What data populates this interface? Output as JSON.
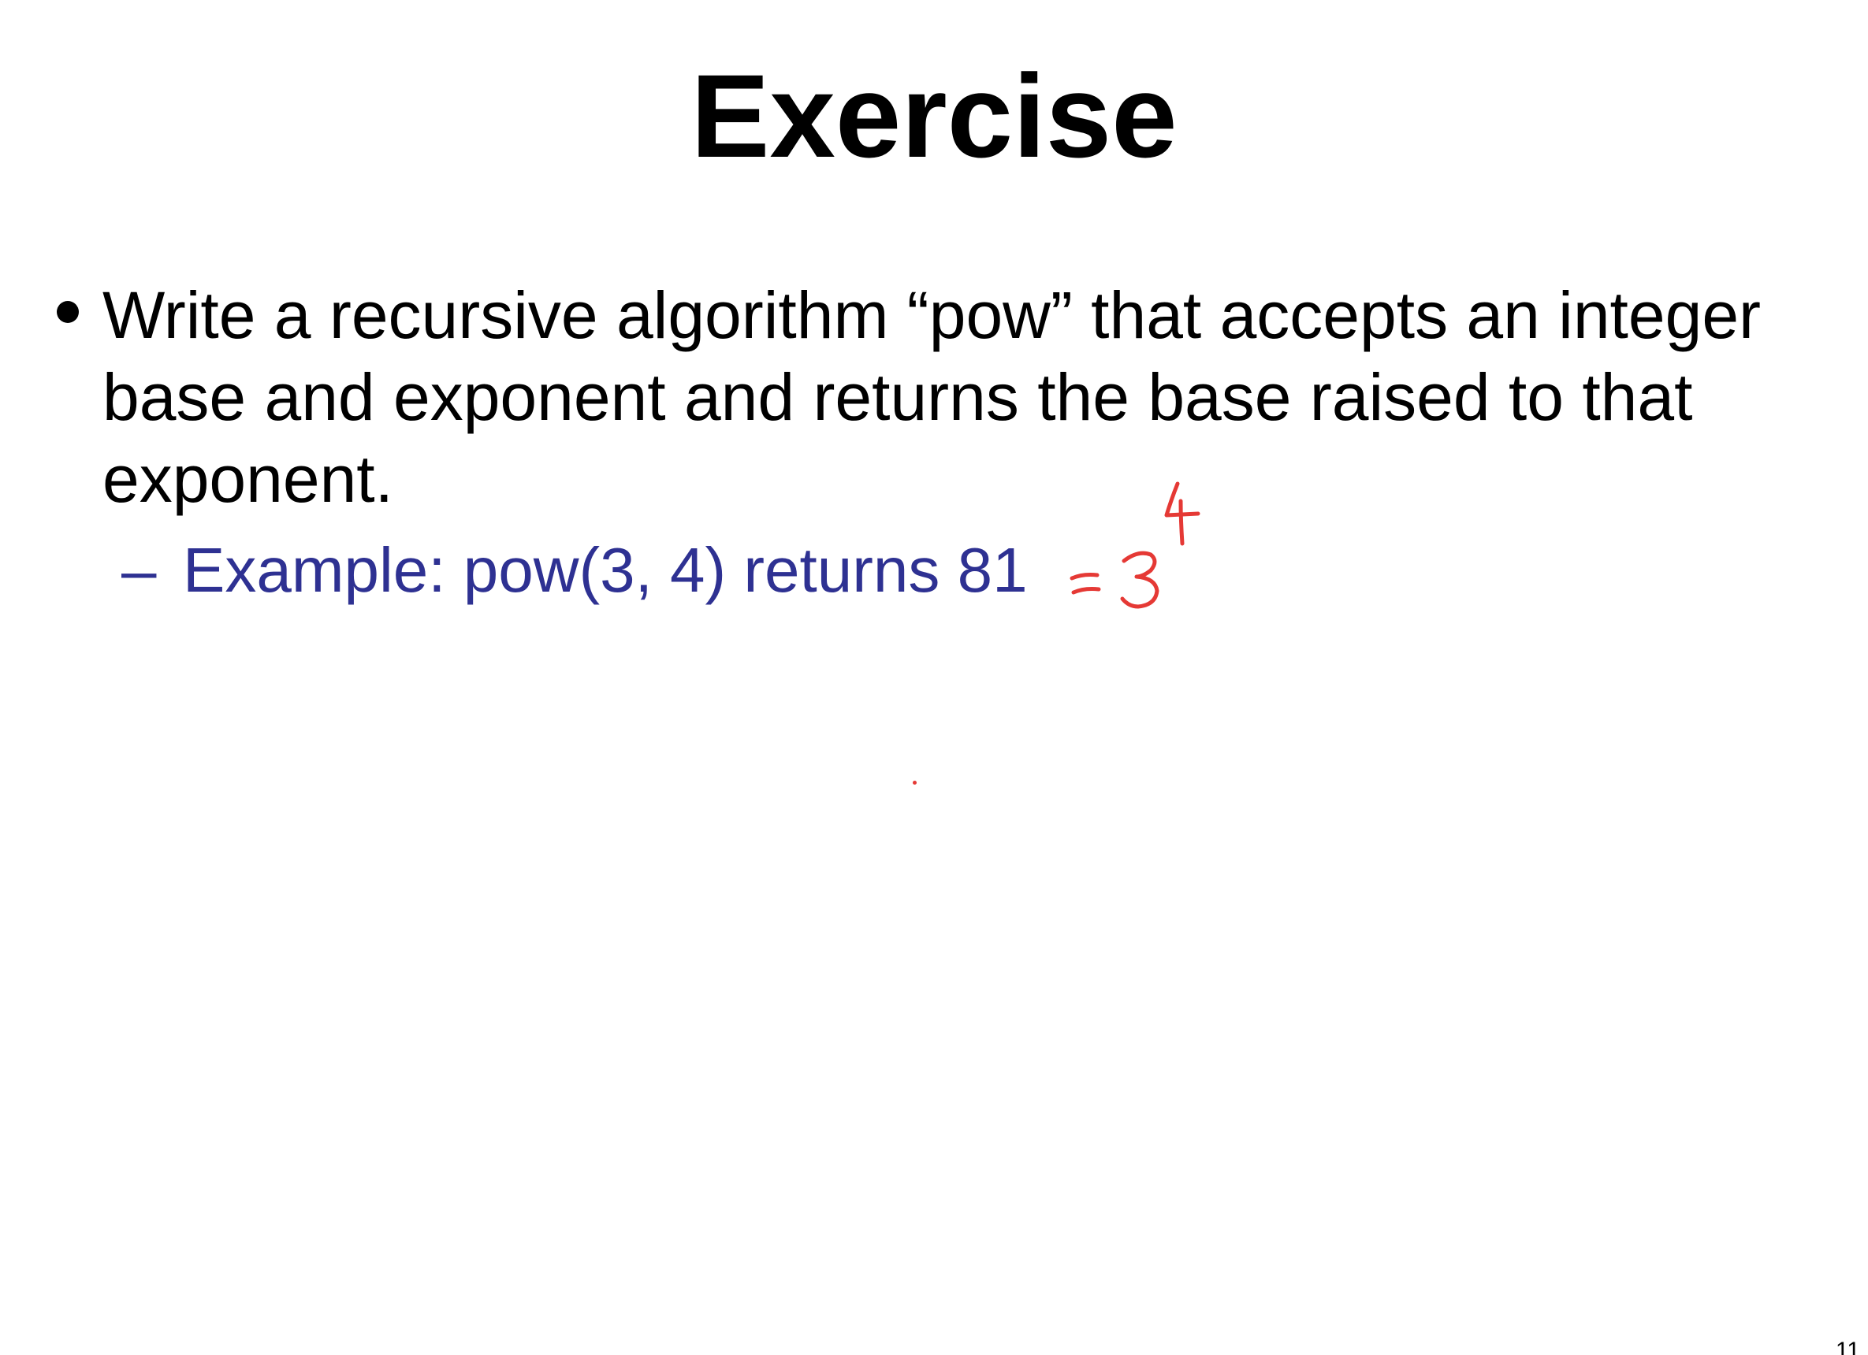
{
  "slide": {
    "title": "Exercise",
    "bullet": {
      "text": "Write a recursive algorithm “pow” that accepts an integer base and exponent and returns the base raised to that exponent."
    },
    "sub_bullet": {
      "dash": "–",
      "text": "Example: pow(3, 4) returns 81"
    },
    "annotation": {
      "color": "#e53935",
      "equals": "=",
      "base": "3",
      "exponent": "4"
    },
    "page_number": "11"
  }
}
